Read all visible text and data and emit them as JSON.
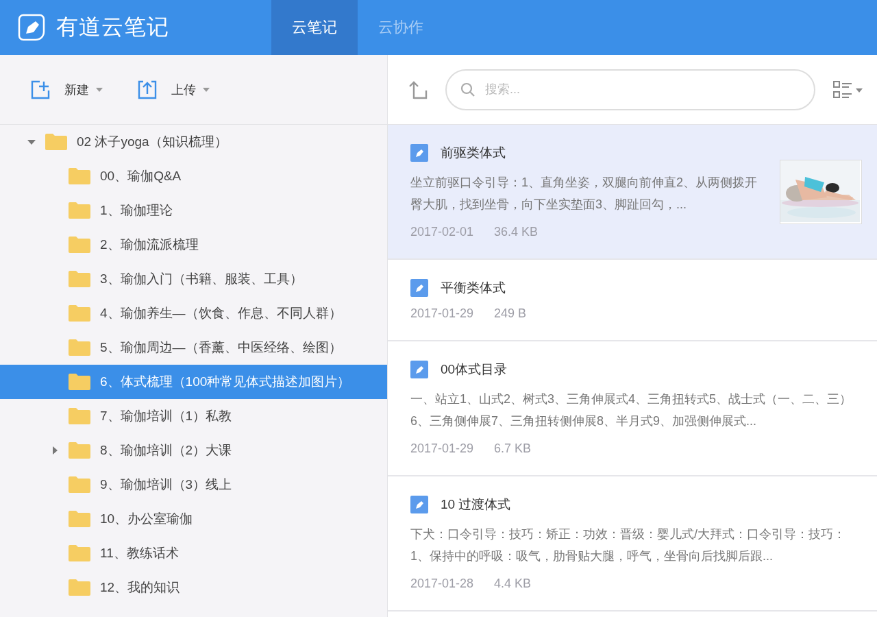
{
  "app": {
    "title": "有道云笔记"
  },
  "tabs": [
    {
      "label": "云笔记",
      "selected": true
    },
    {
      "label": "云协作",
      "selected": false
    }
  ],
  "toolbar": [
    {
      "label": "新建",
      "kind": "new"
    },
    {
      "label": "上传",
      "kind": "upload"
    }
  ],
  "search": {
    "placeholder": "搜索..."
  },
  "tree": [
    {
      "label": "02 沐子yoga（知识梳理）",
      "expanded": true,
      "selected": false,
      "children": [
        {
          "label": "00、瑜伽Q&A",
          "selected": false
        },
        {
          "label": "1、瑜伽理论",
          "selected": false
        },
        {
          "label": "2、瑜伽流派梳理",
          "selected": false
        },
        {
          "label": "3、瑜伽入门（书籍、服装、工具）",
          "selected": false
        },
        {
          "label": "4、瑜伽养生—（饮食、作息、不同人群）",
          "selected": false
        },
        {
          "label": "5、瑜伽周边—（香薰、中医经络、绘图）",
          "selected": false
        },
        {
          "label": "6、体式梳理（100种常见体式描述加图片）",
          "selected": true
        },
        {
          "label": "7、瑜伽培训（1）私教",
          "selected": false
        },
        {
          "label": "8、瑜伽培训（2）大课",
          "selected": false,
          "expanded": false
        },
        {
          "label": "9、瑜伽培训（3）线上",
          "selected": false
        },
        {
          "label": "10、办公室瑜伽",
          "selected": false
        },
        {
          "label": "11、教练话术",
          "selected": false
        },
        {
          "label": "12、我的知识",
          "selected": false
        }
      ]
    }
  ],
  "notes": [
    {
      "title": "前驱类体式",
      "snippet": "坐立前驱口令引导：1、直角坐姿，双腿向前伸直2、从两侧拨开臀大肌，找到坐骨，向下坐实垫面3、脚趾回勾，...",
      "date": "2017-02-01",
      "size": "36.4 KB",
      "selected": true
    },
    {
      "title": "平衡类体式",
      "date": "2017-01-29",
      "size": "249 B",
      "selected": false
    },
    {
      "title": "00体式目录",
      "snippet": "一、站立1、山式2、树式3、三角伸展式4、三角扭转式5、战士式（一、二、三）6、三角侧伸展7、三角扭转侧伸展8、半月式9、加强侧伸展式...",
      "date": "2017-01-29",
      "size": "6.7 KB",
      "selected": false
    },
    {
      "title": "10 过渡体式",
      "snippet": "下犬：口令引导：技巧：矫正：功效：晋级：婴儿式/大拜式：口令引导：技巧：1、保持中的呼吸：吸气，肋骨贴大腿，呼气，坐骨向后找脚后跟...",
      "date": "2017-01-28",
      "size": "4.4 KB",
      "selected": false
    }
  ]
}
